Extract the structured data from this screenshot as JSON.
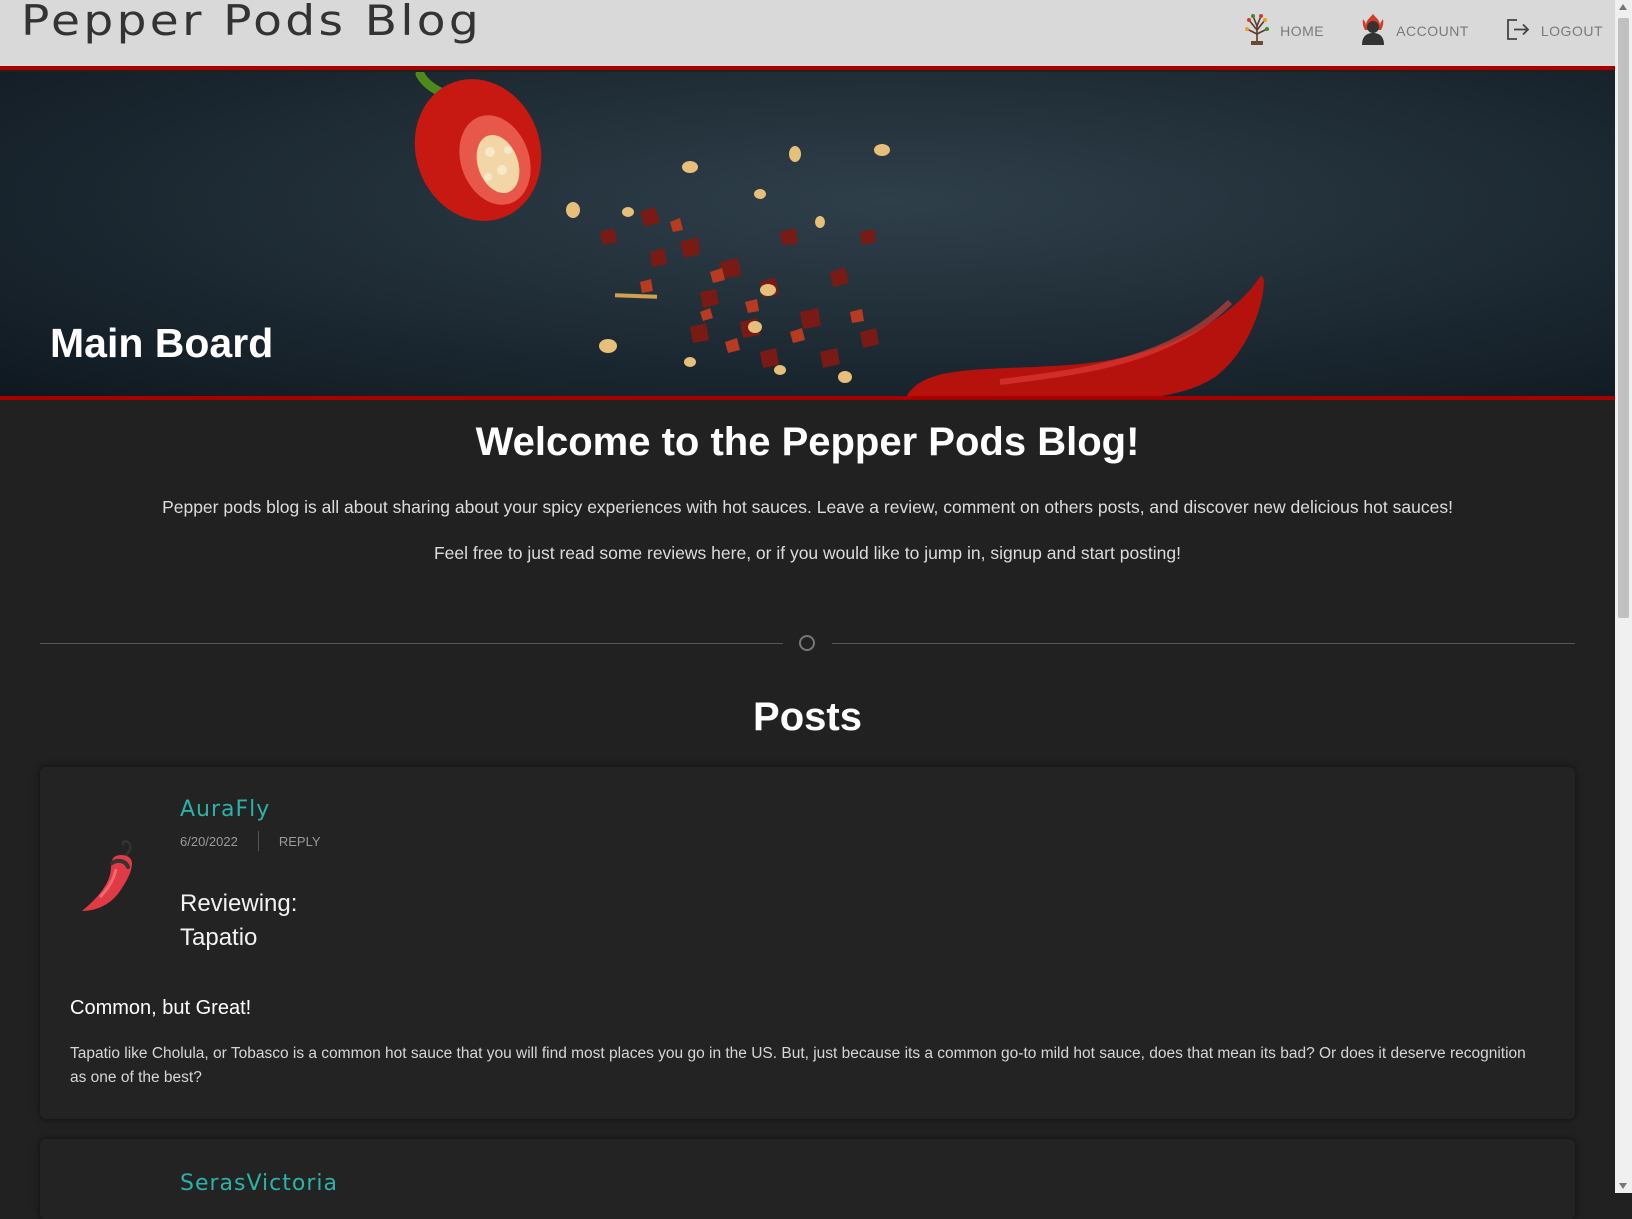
{
  "nav": {
    "brand": "Pepper Pods Blog",
    "links": [
      {
        "label": "HOME",
        "icon": "pepper-tree-icon"
      },
      {
        "label": "ACCOUNT",
        "icon": "user-flame-icon"
      },
      {
        "label": "LOGOUT",
        "icon": "logout-icon"
      }
    ]
  },
  "hero": {
    "title": "Main Board"
  },
  "intro": {
    "welcome": "Welcome to the Pepper Pods Blog!",
    "line1": "Pepper pods blog is all about sharing about your spicy experiences with hot sauces. Leave a review, comment on others posts, and discover new delicious hot sauces!",
    "line2": "Feel free to just read some reviews here, or if you would like to jump in, signup and start posting!"
  },
  "posts": {
    "title": "Posts",
    "items": [
      {
        "author": "AuraFly",
        "date": "6/20/2022",
        "reply": "REPLY",
        "reviewing_label": "Reviewing:",
        "sauce": "Tapatio",
        "headline": "Common, but Great!",
        "body": "Tapatio like Cholula, or Tobasco is a common hot sauce that you will find most places you go in the US. But, just because its a common go-to mild hot sauce, does that mean its bad? Or does it deserve recognition as one of the best?"
      },
      {
        "author": "SerasVictoria"
      }
    ]
  },
  "colors": {
    "accent_red": "#a80000",
    "author_teal": "#2bb3a7",
    "background": "#212121",
    "nav_bg": "#d9d9d9"
  }
}
